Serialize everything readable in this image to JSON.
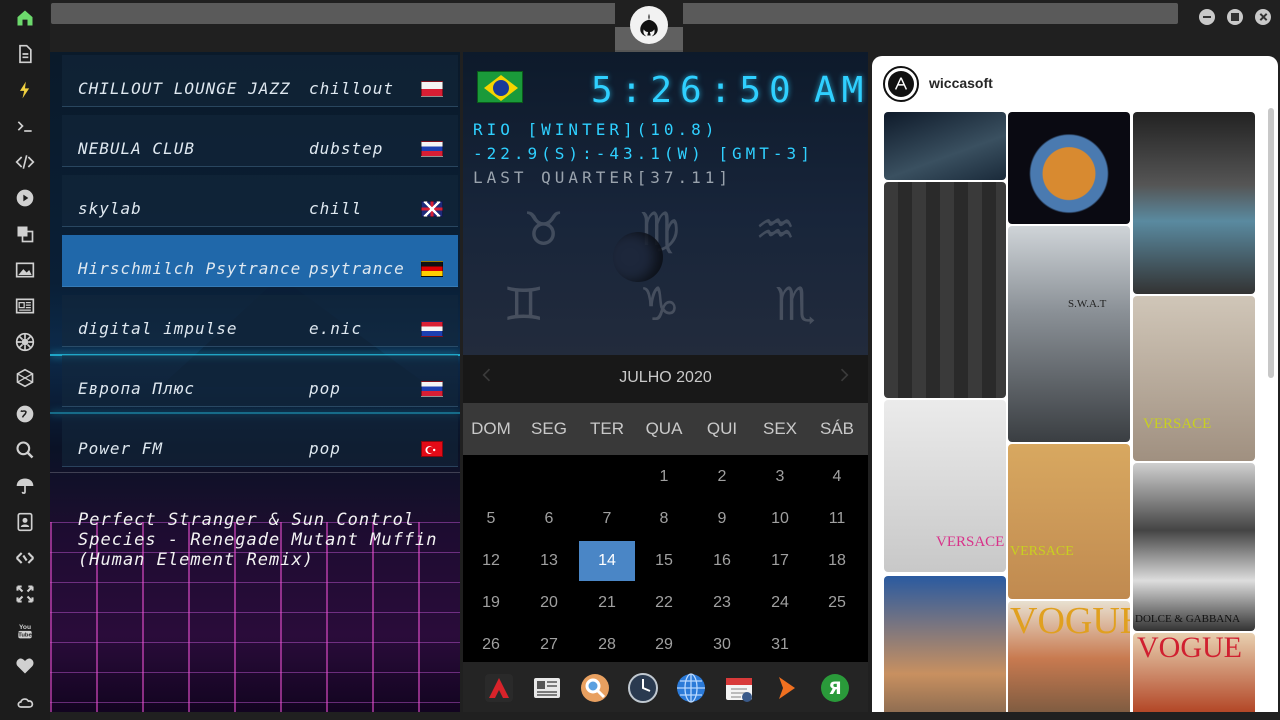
{
  "sidebar": {
    "items": [
      {
        "name": "home-icon",
        "color": "#6cd96c"
      },
      {
        "name": "document-icon",
        "color": "#d0d0d0"
      },
      {
        "name": "lightning-icon",
        "color": "#f0d040"
      },
      {
        "name": "terminal-icon",
        "color": "#d0d0d0"
      },
      {
        "name": "code-icon",
        "color": "#d0d0d0"
      },
      {
        "name": "play-icon",
        "color": "#d0d0d0"
      },
      {
        "name": "translate-icon",
        "color": "#d0d0d0"
      },
      {
        "name": "image-icon",
        "color": "#d0d0d0"
      },
      {
        "name": "news-icon",
        "color": "#d0d0d0"
      },
      {
        "name": "galactic-empire-icon",
        "color": "#d0d0d0"
      },
      {
        "name": "hexagon-icon",
        "color": "#d0d0d0"
      },
      {
        "name": "globe-icon",
        "color": "#d0d0d0"
      },
      {
        "name": "search-icon",
        "color": "#d0d0d0"
      },
      {
        "name": "umbrella-icon",
        "color": "#d0d0d0"
      },
      {
        "name": "contact-icon",
        "color": "#d0d0d0"
      },
      {
        "name": "tag-icon",
        "color": "#d0d0d0"
      },
      {
        "name": "expand-icon",
        "color": "#d0d0d0"
      },
      {
        "name": "youtube-icon",
        "color": "#d0d0d0"
      },
      {
        "name": "heart-icon",
        "color": "#d0d0d0"
      },
      {
        "name": "cloud-icon",
        "color": "#d0d0d0"
      }
    ]
  },
  "window": {
    "emblem": "rebel-alliance-icon"
  },
  "radio": {
    "stations": [
      {
        "name": "CHILLOUT LOUNGE JAZZ",
        "genre": "chillout",
        "flag": "poland",
        "active": false
      },
      {
        "name": "NEBULA CLUB",
        "genre": "dubstep",
        "flag": "russia",
        "active": false
      },
      {
        "name": "skylab",
        "genre": "chill",
        "flag": "uk",
        "active": false
      },
      {
        "name": "Hirschmilch Psytrance",
        "genre": "psytrance",
        "flag": "germany",
        "active": true
      },
      {
        "name": "digital impulse",
        "genre": "e.nic",
        "flag": "croatia",
        "active": false
      },
      {
        "name": "Европа Плюс",
        "genre": "pop",
        "flag": "russia",
        "active": false
      },
      {
        "name": "Power FM",
        "genre": "pop",
        "flag": "turkey",
        "active": false
      }
    ],
    "now_playing": "Perfect Stranger & Sun Control Species - Renegade Mutant Muffin (Human Element Remix)"
  },
  "clock": {
    "country_flag": "brazil",
    "time": "5:26:50",
    "ampm": "AM",
    "location": "RIO [WINTER](10.8)",
    "coords": "-22.9(S):-43.1(W) [GMT-3]",
    "moon": "LAST QUARTER[37.11]",
    "accent_color": "#2fd0ff"
  },
  "calendar": {
    "month_label": "JULHO 2020",
    "prev_icon": "chevron-left-icon",
    "next_icon": "chevron-right-icon",
    "weekdays": [
      "DOM",
      "SEG",
      "TER",
      "QUA",
      "QUI",
      "SEX",
      "SÁB"
    ],
    "first_weekday_index": 3,
    "days_in_month": 31,
    "today": 14,
    "today_color": "#4a86c6"
  },
  "dock": {
    "items": [
      {
        "name": "app-red-a-icon"
      },
      {
        "name": "news-reader-icon"
      },
      {
        "name": "search-magnifier-icon"
      },
      {
        "name": "clock-app-icon"
      },
      {
        "name": "globe-browser-icon"
      },
      {
        "name": "calendar-app-icon"
      },
      {
        "name": "arrow-app-icon"
      },
      {
        "name": "yandex-icon"
      }
    ]
  },
  "instagram": {
    "username": "wiccasoft",
    "photo_labels": [
      "VERSACE",
      "VERSACE",
      "VERSACE",
      "DOLCE & GABBANA",
      "VOGUE",
      "VOGUE",
      "S.W.A.T"
    ]
  }
}
